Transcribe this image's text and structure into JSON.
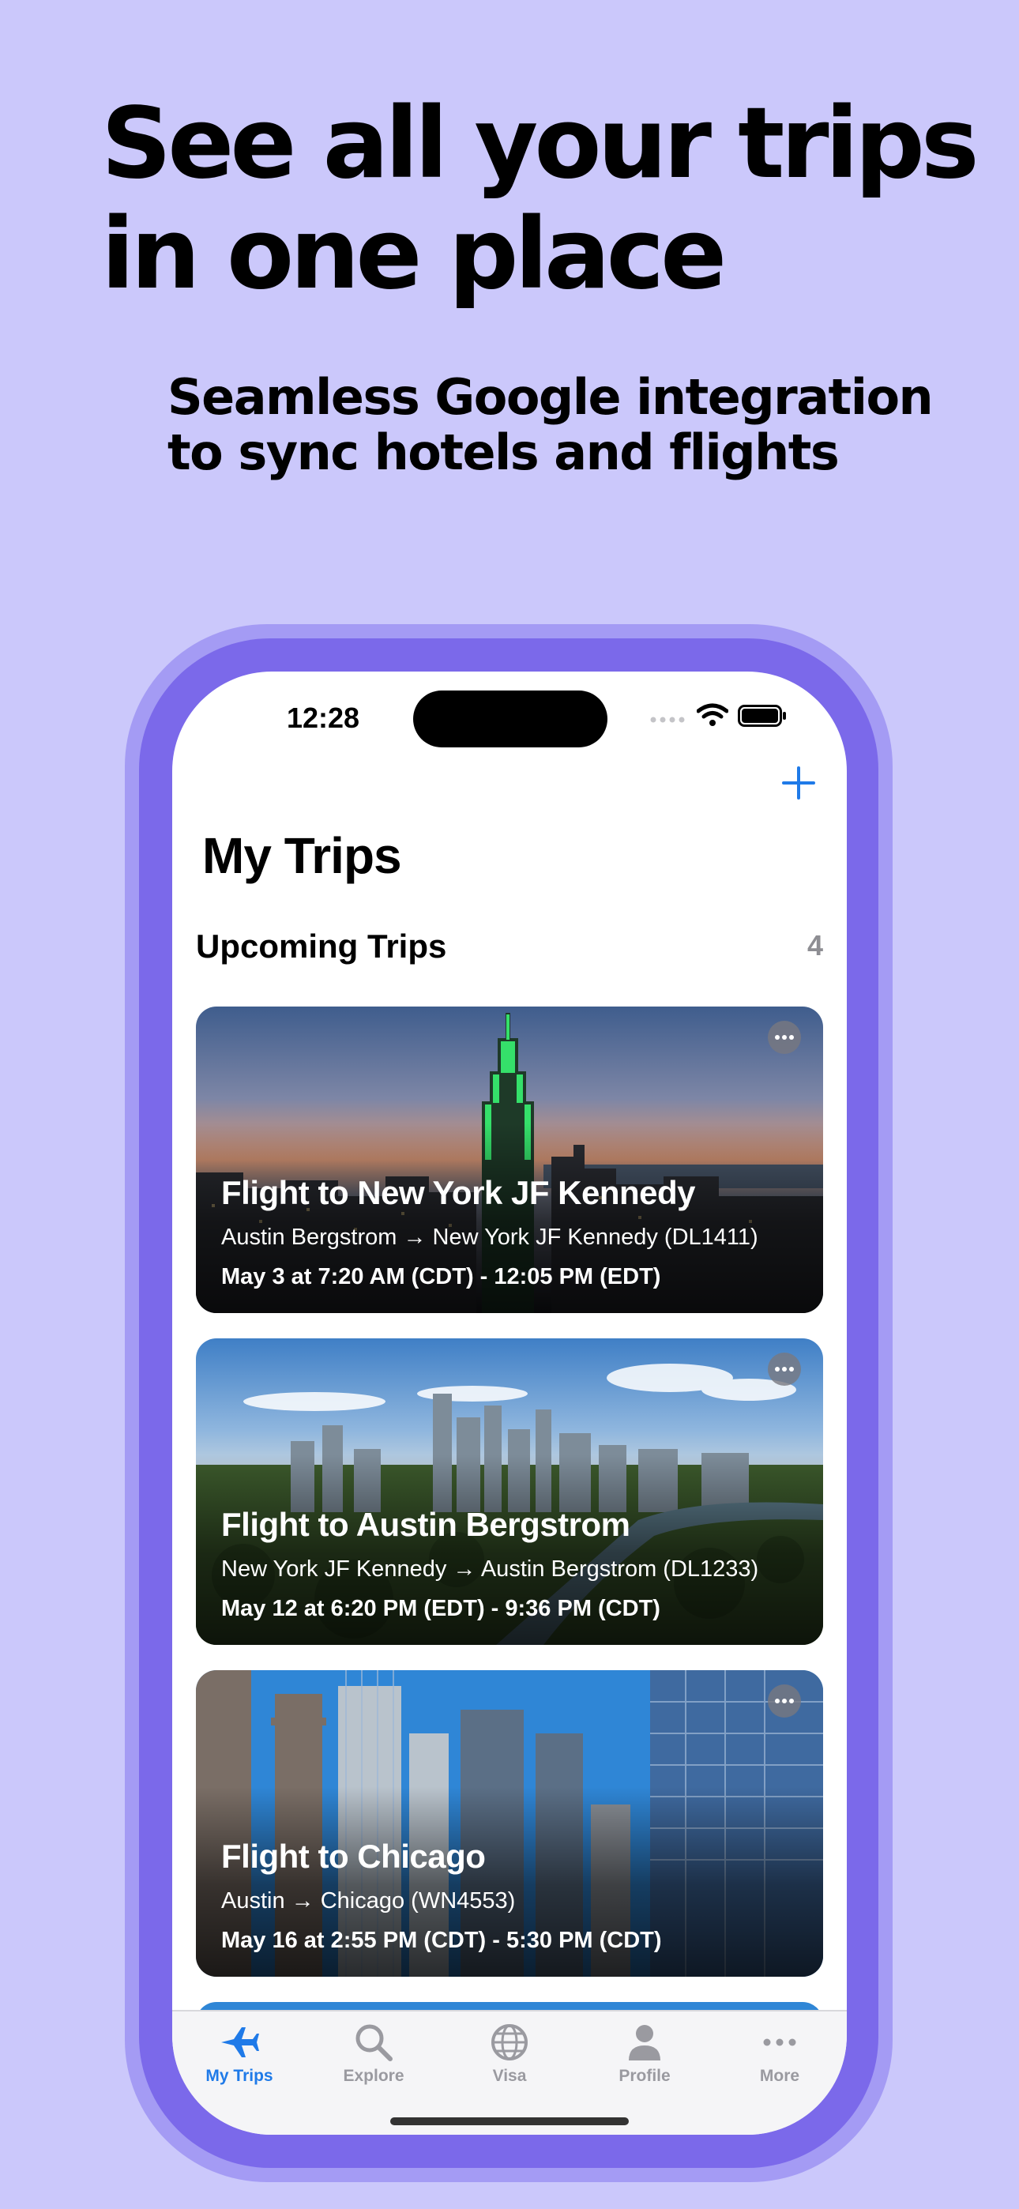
{
  "promo": {
    "headline": "See all your trips in one place",
    "subheadline": "Seamless Google integration to sync hotels and flights"
  },
  "status_bar": {
    "time": "12:28"
  },
  "header": {
    "title": "My Trips",
    "add_icon": "plus-icon"
  },
  "section": {
    "title": "Upcoming Trips",
    "count": "4"
  },
  "trips": [
    {
      "title": "Flight to New York JF Kennedy",
      "route": "Austin Bergstrom → New York JF Kennedy (DL1411)",
      "times": "May 3 at 7:20 AM (CDT) - 12:05 PM (EDT)",
      "image": "new-york-skyline-photo"
    },
    {
      "title": "Flight to Austin Bergstrom",
      "route": "New York JF Kennedy → Austin Bergstrom (DL1233)",
      "times": "May 12 at 6:20 PM (EDT) - 9:36 PM (CDT)",
      "image": "austin-skyline-photo"
    },
    {
      "title": "Flight to Chicago",
      "route": "Austin → Chicago (WN4553)",
      "times": "May 16 at 2:55 PM (CDT) - 5:30 PM (CDT)",
      "image": "chicago-buildings-photo"
    }
  ],
  "tab_bar": {
    "tabs": [
      {
        "label": "My Trips",
        "icon": "airplane-icon",
        "active": true
      },
      {
        "label": "Explore",
        "icon": "magnifying-glass-icon",
        "active": false
      },
      {
        "label": "Visa",
        "icon": "globe-icon",
        "active": false
      },
      {
        "label": "Profile",
        "icon": "person-icon",
        "active": false
      },
      {
        "label": "More",
        "icon": "ellipsis-icon",
        "active": false
      }
    ]
  },
  "colors": {
    "background": "#cbc8fb",
    "phone_frame": "#7b69ea",
    "accent": "#1f7ae8",
    "inactive_tab": "#9a9aa0"
  }
}
